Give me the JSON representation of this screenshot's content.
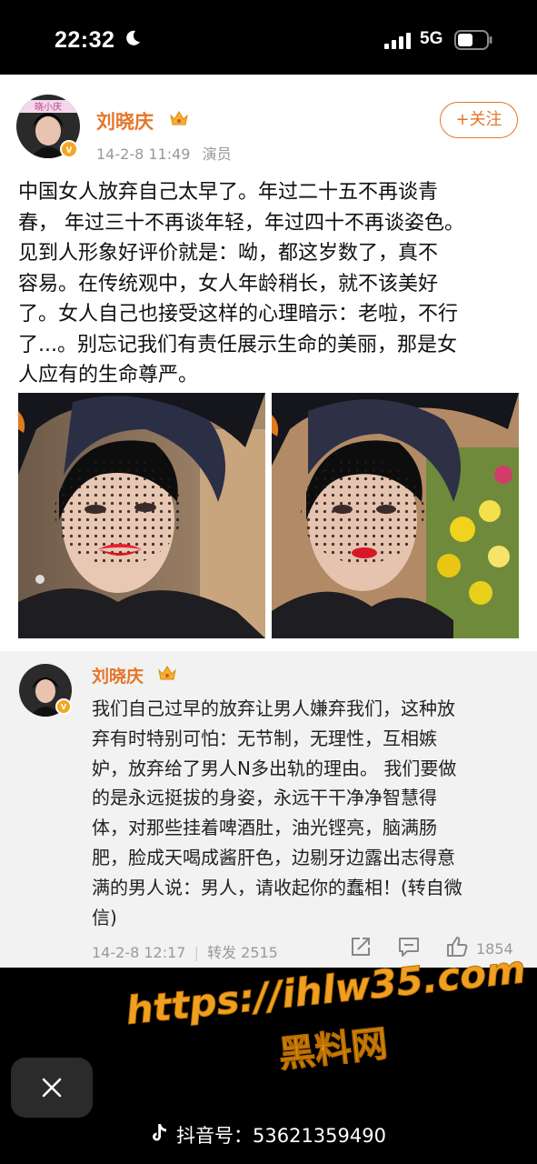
{
  "status_bar": {
    "time": "22:32",
    "network": "5G"
  },
  "post": {
    "author": "刘晓庆",
    "avatar_text": "晓小庆",
    "date": "14-2-8 11:49",
    "meta_label": "演员",
    "follow_label": "+关注",
    "text": "中国女人放弃自己太早了。年过二十五不再谈青\n春， 年过三十不再谈年轻，年过四十不再谈姿色。\n见到人形象好评价就是：呦，都这岁数了，真不\n容易。在传统观中，女人年龄稍长，就不该美好\n了。女人自己也接受这样的心理暗示：老啦，不行\n了...。别忘记我们有责任展示生命的美丽，那是女\n人应有的生命尊严。"
  },
  "repost": {
    "author": "刘晓庆",
    "text": "我们自己过早的放弃让男人嫌弃我们，这种放\n弃有时特别可怕：无节制，无理性，互相嫉\n妒，放弃给了男人N多出轨的理由。 我们要做\n的是永远挺拔的身姿，永远干干净净智慧得\n体，对那些挂着啤酒肚，油光铿亮，脑满肠\n肥，脸成天喝成酱肝色，边剔牙边露出志得意\n满的男人说：男人，请收起你的蠢相！(转自微\n信)",
    "date": "14-2-8 12:17",
    "repost_label": "转发 2515",
    "likes": "1854"
  },
  "watermark": {
    "line1": "https://ihlw35.com",
    "line2": "黑料网"
  },
  "douyin": {
    "label": "抖音号：53621359490"
  },
  "colors": {
    "accent": "#e5762a",
    "watermark": "#f0a020",
    "meta": "#999999",
    "repost_bg": "#f2f2f2"
  },
  "icons": [
    "moon-icon",
    "signal-icon",
    "battery-icon",
    "crown-icon",
    "verified-icon",
    "share-icon",
    "comment-icon",
    "like-icon",
    "close-icon",
    "tiktok-icon"
  ]
}
